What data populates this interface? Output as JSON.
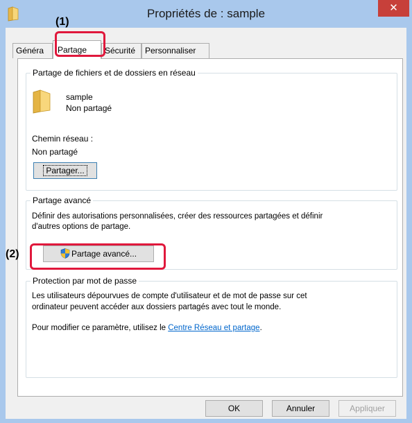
{
  "window": {
    "title": "Propriétés de : sample",
    "close_glyph": "✕"
  },
  "tabs": [
    {
      "label": "Généra"
    },
    {
      "label": "Partage"
    },
    {
      "label": "Sécurité"
    },
    {
      "label": "Personnaliser"
    }
  ],
  "network_sharing": {
    "group_title": "Partage de fichiers et de dossiers en réseau",
    "folder_name": "sample",
    "folder_status": "Non partagé",
    "network_path_label": "Chemin réseau :",
    "network_path_value": "Non partagé",
    "share_button": "Partager..."
  },
  "advanced_sharing": {
    "group_title": "Partage avancé",
    "description_line1": "Définir des autorisations personnalisées, créer des ressources partagées et définir",
    "description_line2": "d'autres options de partage.",
    "button": "Partage avancé..."
  },
  "password_protection": {
    "group_title": "Protection par mot de passe",
    "description_line1": "Les utilisateurs dépourvues de compte d'utilisateur et de mot de passe sur cet",
    "description_line2": "ordinateur peuvent accéder aux dossiers partagés avec tout le monde.",
    "change_text": "Pour modifier ce paramètre, utilisez le ",
    "link_text": "Centre Réseau et partage",
    "change_text_end": "."
  },
  "footer": {
    "ok": "OK",
    "cancel": "Annuler",
    "apply": "Appliquer"
  },
  "callouts": {
    "step1": "(1)",
    "step2": "(2)"
  },
  "colors": {
    "title_bar": "#a9c8ec",
    "close_button": "#c7403a",
    "callout": "#e0183c",
    "link": "#0066cc"
  },
  "icons": {
    "window": "folder-icon",
    "folder": "folder-icon",
    "advanced_button": "uac-shield-icon",
    "close": "close-icon"
  }
}
